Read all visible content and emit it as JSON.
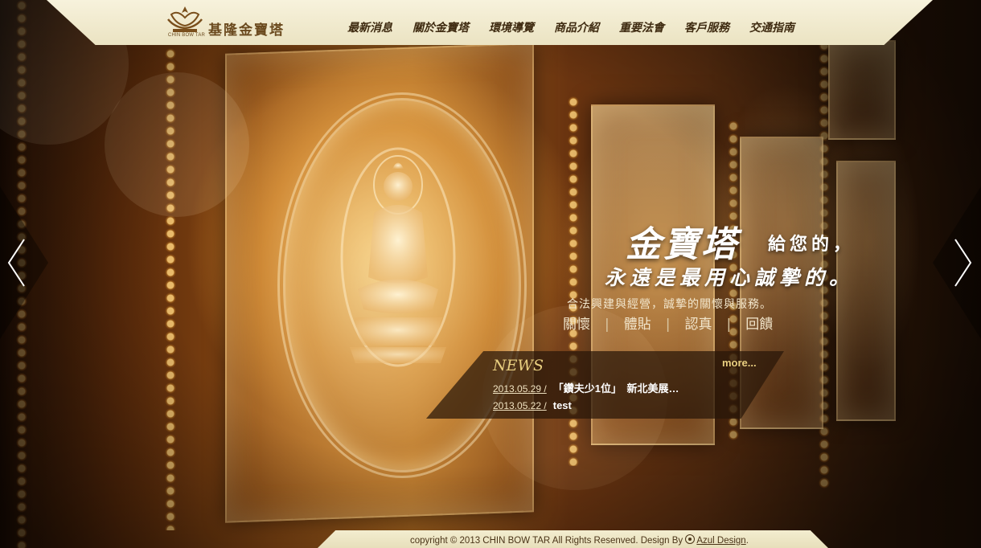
{
  "site": {
    "logo_text": "基隆金寶塔",
    "logo_subtext": "CHIN BOW TAR"
  },
  "nav": {
    "items": [
      {
        "label": "最新消息"
      },
      {
        "label": "關於金寶塔"
      },
      {
        "label": "環境導覽"
      },
      {
        "label": "商品介紹"
      },
      {
        "label": "重要法會"
      },
      {
        "label": "客戶服務"
      },
      {
        "label": "交通指南"
      }
    ]
  },
  "hero": {
    "title": "金寶塔",
    "title_suffix": "給您的，",
    "line2": "永遠是最用心誠摯的。",
    "description": "合法興建與經營，誠摯的關懷與服務。",
    "values": [
      "關懷",
      "體貼",
      "認真",
      "回饋"
    ],
    "separator": "|"
  },
  "carousel": {
    "prev_icon": "chevron-left-icon",
    "next_icon": "chevron-right-icon"
  },
  "news": {
    "title": "NEWS",
    "more_label": "more...",
    "items": [
      {
        "date": "2013.05.29 /",
        "text": "「鑽夫少1位」　新北美展…"
      },
      {
        "date": "2013.05.22 /",
        "text": "test"
      }
    ]
  },
  "footer": {
    "copyright": "copyright © 2013 CHIN BOW TAR All Rights Resenved. Design By",
    "designer": "Azul Design",
    "trailing": "."
  },
  "colors": {
    "header_bg": "#f7f2dc",
    "nav_text": "#3e2a10",
    "news_accent": "#e9cf80",
    "footer_bg": "#f3edcf"
  }
}
